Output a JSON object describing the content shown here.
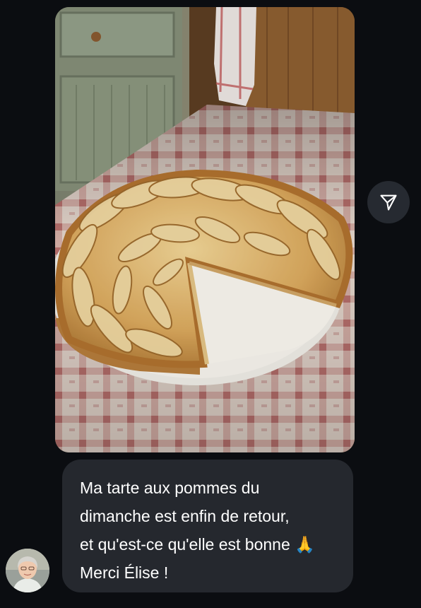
{
  "conversation": {
    "photo": {
      "subject": "apple-tart-photo"
    },
    "share_icon": "paper-plane-icon",
    "message": {
      "lines": [
        "Ma tarte aux pommes du",
        "dimanche est enfin de retour,",
        "et qu'est-ce qu'elle est bonne 🙏",
        "Merci Élise !"
      ]
    },
    "avatar": {
      "icon": "user-avatar"
    }
  },
  "colors": {
    "background": "#0b0d11",
    "bubble": "#25282e",
    "share_button": "#262a31",
    "text": "#ffffff"
  }
}
